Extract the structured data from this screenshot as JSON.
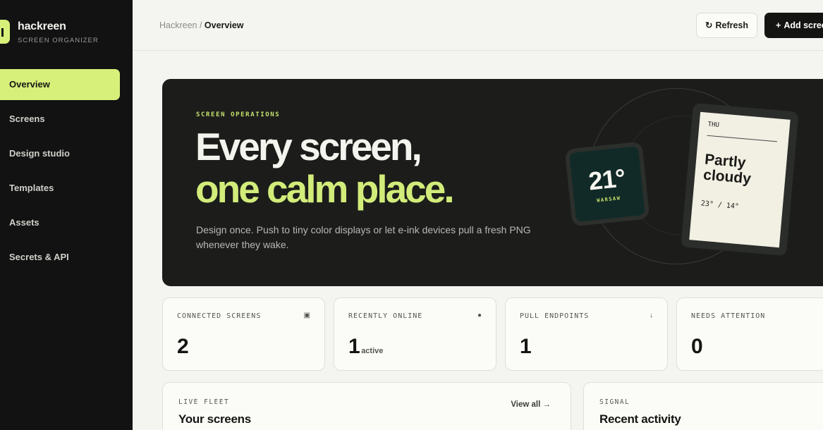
{
  "brand": {
    "name": "hackreen",
    "subtitle": "SCREEN ORGANIZER",
    "accent": "#d7f07a"
  },
  "sidebar": {
    "items": [
      {
        "label": "Overview",
        "active": true
      },
      {
        "label": "Screens"
      },
      {
        "label": "Design studio"
      },
      {
        "label": "Templates"
      },
      {
        "label": "Assets"
      },
      {
        "label": "Secrets & API"
      }
    ]
  },
  "header": {
    "breadcrumb_root": "Hackreen",
    "breadcrumb_sep": " / ",
    "breadcrumb_current": "Overview",
    "refresh_icon": "↻",
    "refresh_label": "Refresh",
    "add_icon": "+",
    "add_label": "Add screen"
  },
  "hero": {
    "eyebrow": "SCREEN OPERATIONS",
    "headline_line1": "Every screen,",
    "headline_line2": "one calm place.",
    "description": "Design once. Push to tiny color displays or let e-ink devices pull a fresh PNG whenever they wake.",
    "tile_temp": "21°",
    "tile_city": "WARSAW",
    "eink_day": "THU",
    "eink_condition": "Partly cloudy",
    "eink_range": "23° / 14°"
  },
  "stats": [
    {
      "label": "CONNECTED SCREENS",
      "icon": "▣",
      "value": "2",
      "unit": ""
    },
    {
      "label": "RECENTLY ONLINE",
      "icon": "●",
      "value": "1",
      "unit": "active"
    },
    {
      "label": "PULL ENDPOINTS",
      "icon": "↓",
      "value": "1",
      "unit": ""
    },
    {
      "label": "NEEDS ATTENTION",
      "icon": "!",
      "value": "0",
      "unit": ""
    }
  ],
  "panels": {
    "fleet": {
      "eyebrow": "LIVE FLEET",
      "title": "Your screens",
      "link": "View all →"
    },
    "signal": {
      "eyebrow": "SIGNAL",
      "title": "Recent activity"
    }
  }
}
